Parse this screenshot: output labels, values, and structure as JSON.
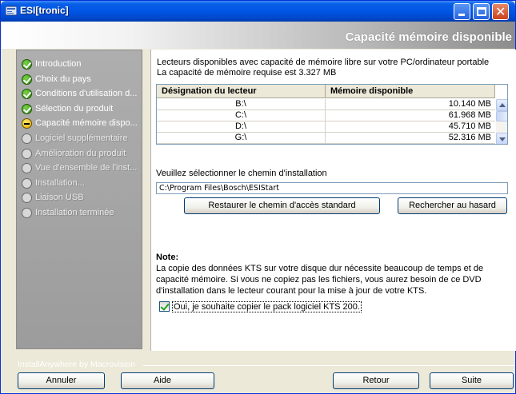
{
  "window": {
    "title": "ESI[tronic]"
  },
  "header": {
    "title": "Capacité mémoire disponible"
  },
  "steps": [
    {
      "label": "Introduction",
      "status": "done"
    },
    {
      "label": "Choix du pays",
      "status": "done"
    },
    {
      "label": "Conditions d'utilisation d...",
      "status": "done"
    },
    {
      "label": "Sélection du produit",
      "status": "done"
    },
    {
      "label": "Capacité mémoire dispo...",
      "status": "current"
    },
    {
      "label": "Logiciel supplémentaire",
      "status": "pending"
    },
    {
      "label": "Amélioration du produit",
      "status": "pending"
    },
    {
      "label": "Vue d'ensemble de l'inst...",
      "status": "pending"
    },
    {
      "label": "Installation...",
      "status": "pending"
    },
    {
      "label": "Liaison USB",
      "status": "pending"
    },
    {
      "label": "Installation terminée",
      "status": "pending"
    }
  ],
  "main": {
    "intro_line1": "Lecteurs disponibles avec capacité de mémoire libre sur votre PC/ordinateur portable",
    "intro_line2": "La capacité de mémoire requise est 3.327 MB",
    "table": {
      "col_drive": "Désignation du lecteur",
      "col_memory": "Mémoire disponible",
      "rows": [
        {
          "drive": "B:\\",
          "memory": "10.140  MB"
        },
        {
          "drive": "C:\\",
          "memory": "61.968  MB"
        },
        {
          "drive": "D:\\",
          "memory": "45.710  MB"
        },
        {
          "drive": "G:\\",
          "memory": "52.316  MB"
        }
      ]
    },
    "path_label": "Veuillez sélectionner le chemin d'installation",
    "path_value": "C:\\Program Files\\Bosch\\ESIStart",
    "restore_button": "Restaurer le chemin d'accès standard",
    "browse_button": "Rechercher au hasard",
    "note_title": "Note:",
    "note_line1": "La copie des données KTS sur votre disque dur nécessite beaucoup de temps et de",
    "note_line2": "capacité mémoire. Si vous ne copiez pas les fichiers, vous aurez besoin de ce DVD",
    "note_line3": "d'installation dans le lecteur courant pour la mise à jour de votre KTS.",
    "checkbox_label": "Oui, je souhaite copier le pack logiciel KTS 200.",
    "checkbox_checked": true
  },
  "footer": {
    "vendor": "InstallAnywhere by Macrovision",
    "cancel": "Annuler",
    "help": "Aide",
    "back": "Retour",
    "next": "Suite"
  }
}
